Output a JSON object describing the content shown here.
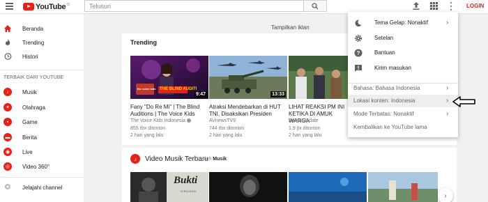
{
  "header": {
    "logo_text": "YouTube",
    "logo_sup": "ID",
    "search_placeholder": "Telusuri",
    "login_label": "LOGIN"
  },
  "sidebar": {
    "items": [
      {
        "label": "Beranda",
        "icon": "home-icon"
      },
      {
        "label": "Trending",
        "icon": "flame-icon"
      },
      {
        "label": "Histori",
        "icon": "history-icon"
      }
    ],
    "heading": "TERBAIK DARI YOUTUBE",
    "best": [
      {
        "label": "Musik",
        "icon": "music-icon"
      },
      {
        "label": "Olahraga",
        "icon": "sports-icon"
      },
      {
        "label": "Game",
        "icon": "game-icon"
      },
      {
        "label": "Berita",
        "icon": "news-icon"
      },
      {
        "label": "Live",
        "icon": "live-icon"
      },
      {
        "label": "Video 360°",
        "icon": "video360-icon"
      }
    ],
    "browse_channels": "Jelajahi channel"
  },
  "main": {
    "promo": "Tampilkan iklan",
    "trending": {
      "title": "Trending",
      "videos": [
        {
          "title": "Fany \"Do Re Mi\" | The Blind Auditions | The Voice Kids",
          "channel": "The Voice Kids Indonesia",
          "views": "855 rbx ditonton",
          "ago": "2 hari yang lalu",
          "duration": "9:47",
          "thumb_text": "THE BLIND AUDITI",
          "thumb_logo": "the voice kids"
        },
        {
          "title": "Atraksi Mendebarkan di HUT TNI, Disaksikan Presiden",
          "channel": "AVnewsTV9",
          "views": "744 rbx ditonton",
          "ago": "2 hari yang lalu",
          "duration": "13:33"
        },
        {
          "title": "LIHAT REAKSI PM INI KETIKA DI AMUK WARGA",
          "channel": "Berita Update",
          "views": "1,9 jtx ditonton",
          "ago": "2 hari yang lalu",
          "duration": ""
        }
      ]
    },
    "video_musik": {
      "title": "Video Musik Terbaru",
      "by_label": "oleh",
      "by_name": "Musik",
      "thumb_text": "Bukti",
      "thumb_sub": "VIRGOUN"
    }
  },
  "menu": {
    "items": [
      {
        "label": "Tema Gelap: Nonaktif",
        "icon": "moon-icon",
        "chevron": true
      },
      {
        "label": "Setelan",
        "icon": "gear-icon",
        "chevron": false
      },
      {
        "label": "Bantuan",
        "icon": "help-icon",
        "chevron": false
      },
      {
        "label": "Kirim masukan",
        "icon": "feedback-icon",
        "chevron": false
      }
    ],
    "options": [
      {
        "label": "Bahasa: Bahasa Indonesia",
        "chevron": true
      },
      {
        "label": "Lokasi konten: Indonesia",
        "chevron": true
      },
      {
        "label": "Mode Terbatas: Nonaktif",
        "chevron": true
      },
      {
        "label": "Kembalikan ke YouTube lama",
        "chevron": false
      }
    ]
  },
  "colors": {
    "brand_red": "#e62117",
    "background": "#f1f1f1"
  }
}
